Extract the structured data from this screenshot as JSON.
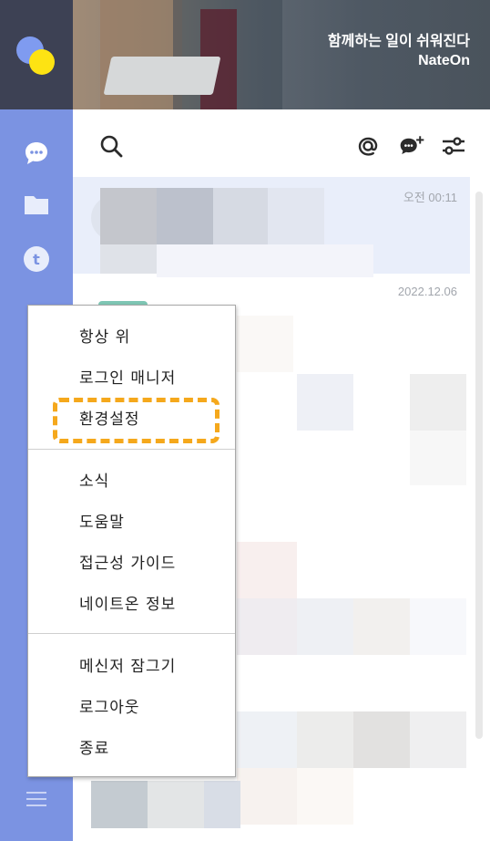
{
  "banner": {
    "headline": "함께하는 일이 쉬워진다",
    "brand": "NateOn"
  },
  "rail": {
    "items": [
      {
        "icon": "chat-bubble-icon"
      },
      {
        "icon": "folder-icon"
      },
      {
        "icon": "t-circle-icon"
      },
      {
        "icon": "menu-hamburger-icon"
      }
    ]
  },
  "toolbar": {
    "icons": [
      "search-icon",
      "at-mention-icon",
      "new-chat-icon",
      "filter-sliders-icon"
    ]
  },
  "chat_list": {
    "items": [
      {
        "time": "오전 00:11"
      },
      {
        "time": "2022.12.06"
      }
    ]
  },
  "context_menu": {
    "groups": [
      {
        "items": [
          "항상 위",
          "로그인 매니저",
          "환경설정"
        ]
      },
      {
        "items": [
          "소식",
          "도움말",
          "접근성 가이드",
          "네이트온 정보"
        ]
      },
      {
        "items": [
          "메신저 잠그기",
          "로그아웃",
          "종료"
        ]
      }
    ],
    "highlighted": "환경설정"
  },
  "colors": {
    "rail": "#7b93e2",
    "rail_top": "#3d4154",
    "highlight": "#f5a81c",
    "selected_row": "#e9eefa"
  }
}
